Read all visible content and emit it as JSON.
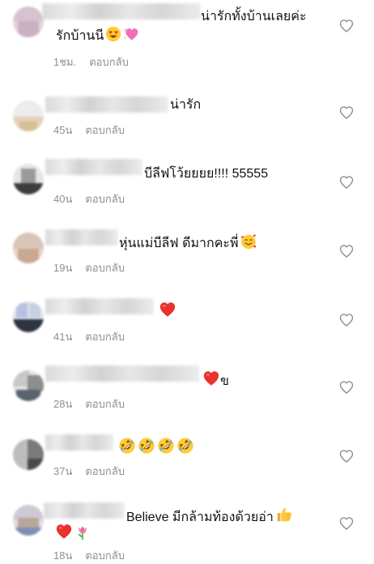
{
  "comments": [
    {
      "text": "น่ารักทั้งบ้านเลยค่ะ",
      "text2": "รักบ้านนี",
      "time": "1ชม.",
      "reply": "ตอบกลับ"
    },
    {
      "text": "น่ารัก",
      "time": "45น",
      "reply": "ตอบกลับ"
    },
    {
      "text": "บีลีฟโว้ยยยย!!!! 55555",
      "time": "40น",
      "reply": "ตอบกลับ"
    },
    {
      "text": "หุ่นแม่บีลีฟ ดีมากคะพี่",
      "time": "19น",
      "reply": "ตอบกลับ"
    },
    {
      "text": "",
      "time": "41น",
      "reply": "ตอบกลับ"
    },
    {
      "text": "ข",
      "time": "28น",
      "reply": "ตอบกลับ"
    },
    {
      "text": "",
      "time": "37น",
      "reply": "ตอบกลับ"
    },
    {
      "text": "Believe มีกล้ามท้องด้วยอ่า",
      "time": "18น",
      "reply": "ตอบกลับ"
    }
  ],
  "icons": {
    "like": "heart-outline-icon",
    "red_heart": "red-heart-emoji",
    "heart_eyes": "heart-eyes-emoji",
    "sparkling_heart": "sparkling-heart-emoji",
    "smiling_hearts": "smiling-face-with-hearts-emoji",
    "rofl": "rolling-on-floor-laughing-emoji",
    "thumbs_up": "thumbs-up-emoji",
    "tulip": "tulip-emoji"
  },
  "colors": {
    "text": "#111111",
    "meta": "#8e8e8e",
    "heart_red": "#e8322e"
  }
}
